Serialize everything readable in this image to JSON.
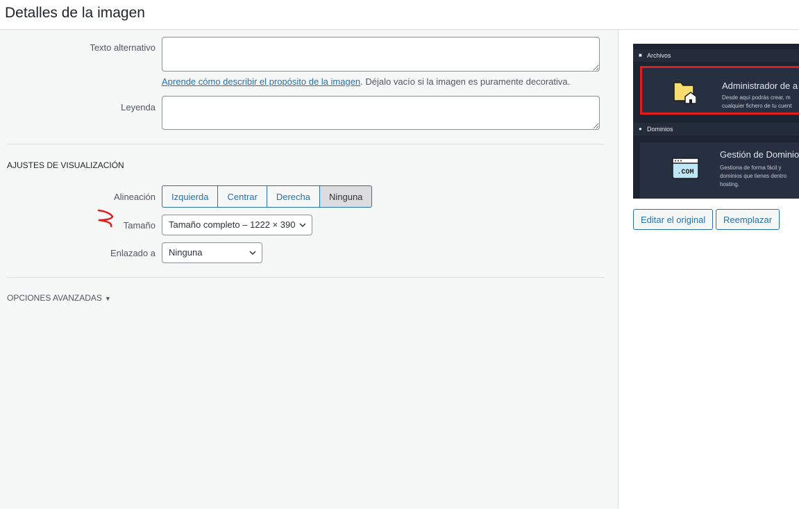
{
  "header": {
    "title": "Detalles de la imagen"
  },
  "fields": {
    "alt_label": "Texto alternativo",
    "alt_value": "",
    "help_link": "Aprende cómo describir el propósito de la imagen",
    "help_text": ". Déjalo vacío si la imagen es puramente decorativa.",
    "caption_label": "Leyenda",
    "caption_value": ""
  },
  "display": {
    "section_title": "AJUSTES DE VISUALIZACIÓN",
    "align_label": "Alineación",
    "align_options": [
      "Izquierda",
      "Centrar",
      "Derecha",
      "Ninguna"
    ],
    "align_selected": "Ninguna",
    "size_label": "Tamaño",
    "size_value": "Tamaño completo – 1222 × 390",
    "link_label": "Enlazado a",
    "link_value": "Ninguna"
  },
  "advanced": {
    "label": "OPCIONES AVANZADAS"
  },
  "preview": {
    "files_header": "Archivos",
    "files_title": "Administrador de a",
    "files_desc1": "Desde aquí podrás crear, m",
    "files_desc2": "cualquier fichero de tu cuent",
    "domains_header": "Dominios",
    "domains_title": "Gestión de Dominio",
    "domains_desc1": "Gestiona de forma fácil y",
    "domains_desc2": "dominios que tienes dentro",
    "domains_desc3": "hosting.",
    "com_text": ".COM",
    "accent": "#e01e1e"
  },
  "actions": {
    "edit_original": "Editar el original",
    "replace": "Reemplazar"
  },
  "colors": {
    "link": "#2271b1",
    "annotation": "#e02020"
  }
}
